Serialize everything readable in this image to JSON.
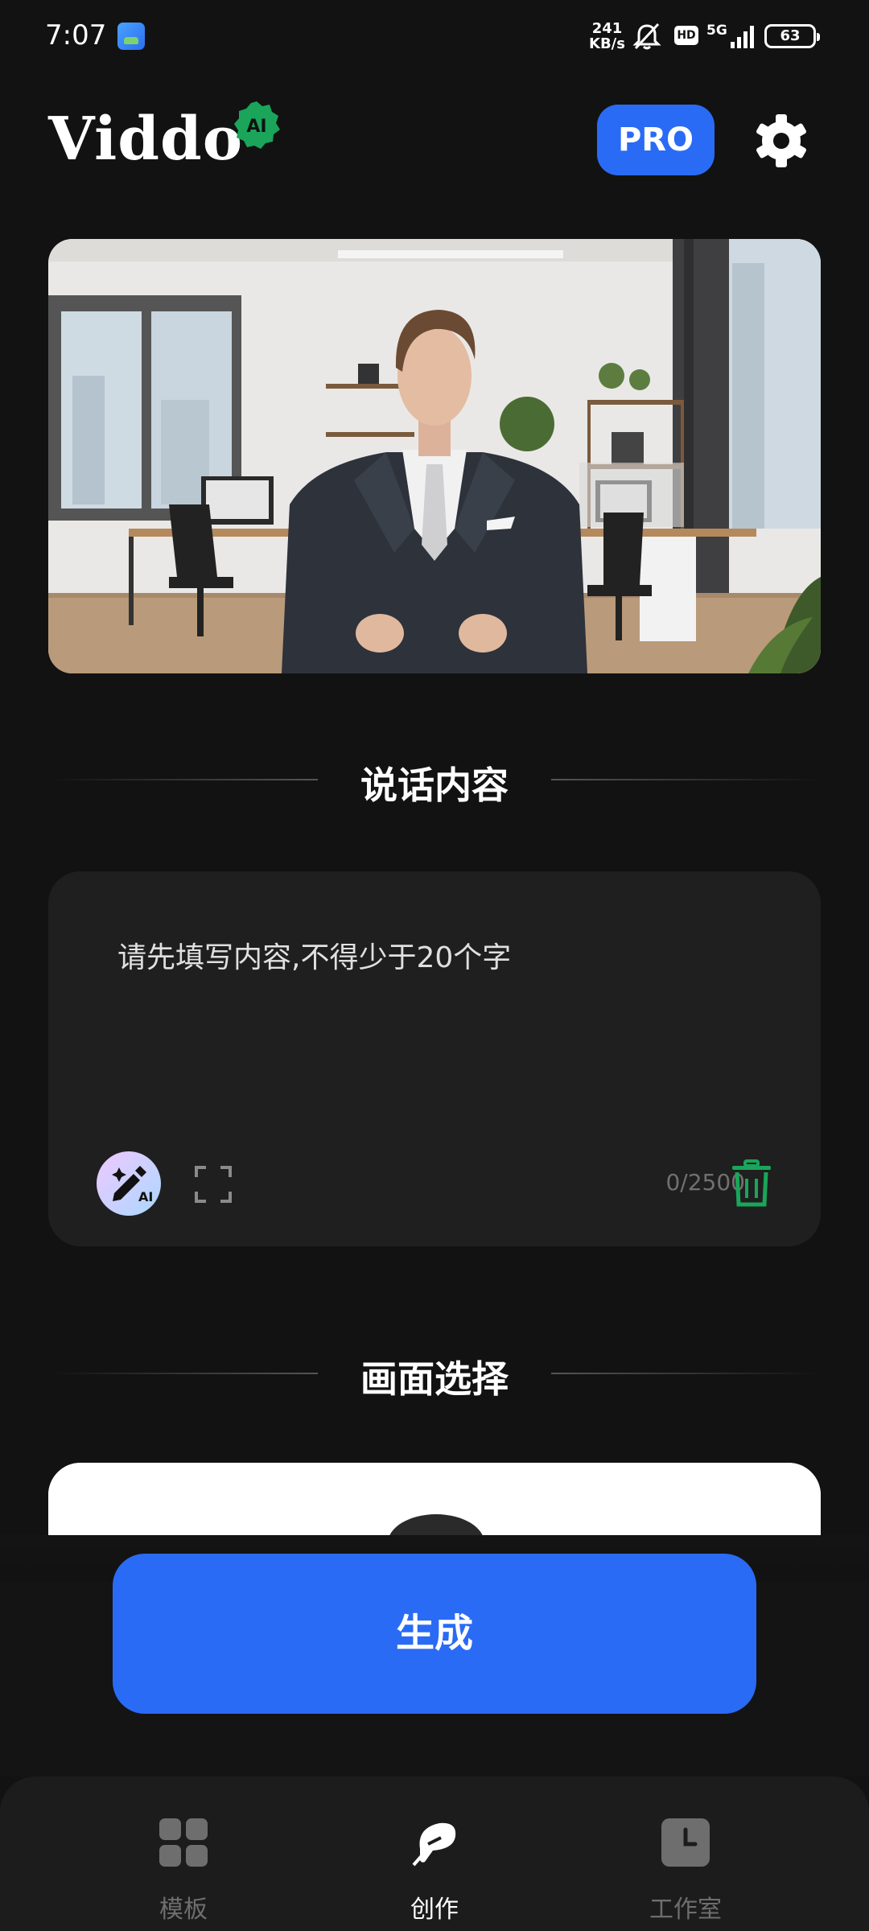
{
  "status_bar": {
    "time": "7:07",
    "speed_value": "241",
    "speed_unit": "KB/s",
    "hd": "HD",
    "network": "5G",
    "battery": "63"
  },
  "header": {
    "logo": "Viddo",
    "logo_badge": "AI",
    "pro_label": "PRO",
    "settings_icon": "gear-icon"
  },
  "speech_section": {
    "title": "说话内容",
    "placeholder": "请先填写内容,不得少于20个字",
    "value": "",
    "counter": "0/2500",
    "ai_button_badge": "AI"
  },
  "scene_section": {
    "title": "画面选择"
  },
  "generate_label": "生成",
  "nav": {
    "items": [
      {
        "label": "模板",
        "icon": "grid-icon",
        "active": false
      },
      {
        "label": "创作",
        "icon": "quill-icon",
        "active": true
      },
      {
        "label": "工作室",
        "icon": "clock-icon",
        "active": false
      }
    ]
  },
  "colors": {
    "background": "#121212",
    "accent": "#2a6bf5",
    "badge_green": "#1aa55a",
    "card": "#1f1f1f"
  }
}
